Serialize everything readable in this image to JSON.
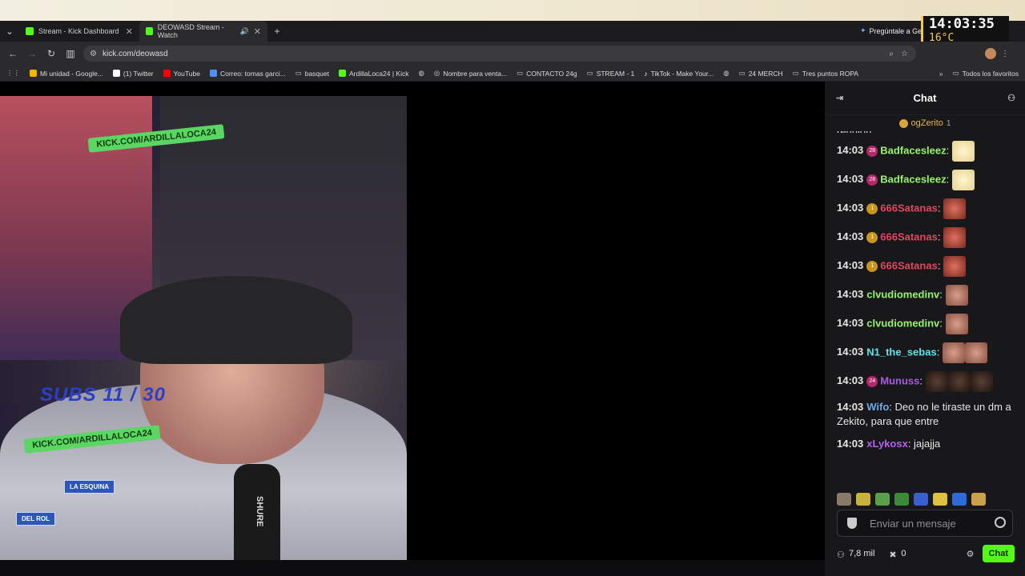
{
  "tabs": [
    {
      "title": "Stream - Kick Dashboard"
    },
    {
      "title": "DEOWASD Stream - Watch"
    }
  ],
  "gemini_prompt": "Pregúntale a Gemini",
  "clock": {
    "time": "14:03:35",
    "temp": "16°C"
  },
  "address": {
    "url": "kick.com/deowasd"
  },
  "bookmarks": [
    {
      "label": "Mi unidad - Google...",
      "color": "#f4b400"
    },
    {
      "label": "(1) Twitter",
      "color": "#ffffff"
    },
    {
      "label": "YouTube",
      "color": "#ff0000"
    },
    {
      "label": "Correo: tomas garci...",
      "color": "#4f8ef7"
    },
    {
      "label": "basquet",
      "color": "#aaaaaa"
    },
    {
      "label": "ArdillaLoca24 | Kick",
      "color": "#53fc18"
    },
    {
      "label": "",
      "color": "#cccccc"
    },
    {
      "label": "Nombre para venta...",
      "color": "#cccccc"
    },
    {
      "label": "CONTACTO 24g",
      "color": "#aaaaaa"
    },
    {
      "label": "STREAM - 1",
      "color": "#aaaaaa"
    },
    {
      "label": "TikTok - Make Your...",
      "color": "#ffffff"
    },
    {
      "label": "",
      "color": "#cccccc"
    },
    {
      "label": "24 MERCH",
      "color": "#aaaaaa"
    },
    {
      "label": "Tres puntos  ROPA",
      "color": "#aaaaaa"
    }
  ],
  "bookmarks_all": "Todos los favoritos",
  "overlay": {
    "banner_top": "KICK.COM/ARDILLALOCA24",
    "banner_bottom": "KICK.COM/ARDILLALOCA24",
    "subs": "SUBS 11 / 30",
    "sign1": "LA ESQUINA",
    "sign2": "DEL ROL",
    "mic_brand": "SHURE"
  },
  "chat": {
    "title": "Chat",
    "pinned_user": "ogZerito",
    "pinned_count": "1",
    "partial_text": "reunion",
    "messages": [
      {
        "time": "14:03",
        "badge": "28",
        "badge_color": "#b3286a",
        "user": "Badfacesleez",
        "user_color": "#9af26a",
        "text": "",
        "emotes": [
          "anime"
        ]
      },
      {
        "time": "14:03",
        "badge": "28",
        "badge_color": "#b3286a",
        "user": "Badfacesleez",
        "user_color": "#9af26a",
        "text": "",
        "emotes": [
          "anime"
        ]
      },
      {
        "time": "14:03",
        "badge": "1",
        "badge_color": "#c8951f",
        "user": "666Satanas",
        "user_color": "#e0475d",
        "text": "",
        "emotes": [
          "red"
        ]
      },
      {
        "time": "14:03",
        "badge": "1",
        "badge_color": "#c8951f",
        "user": "666Satanas",
        "user_color": "#e0475d",
        "text": "",
        "emotes": [
          "red"
        ]
      },
      {
        "time": "14:03",
        "badge": "1",
        "badge_color": "#c8951f",
        "user": "666Satanas",
        "user_color": "#e0475d",
        "text": "",
        "emotes": [
          "red"
        ]
      },
      {
        "time": "14:03",
        "badge": "",
        "badge_color": "",
        "user": "clvudiomedinv",
        "user_color": "#9af26a",
        "text": "",
        "emotes": [
          "face"
        ]
      },
      {
        "time": "14:03",
        "badge": "",
        "badge_color": "",
        "user": "clvudiomedinv",
        "user_color": "#9af26a",
        "text": "",
        "emotes": [
          "face"
        ]
      },
      {
        "time": "14:03",
        "badge": "",
        "badge_color": "",
        "user": "N1_the_sebas",
        "user_color": "#5fe3e8",
        "text": "",
        "emotes": [
          "face",
          "face"
        ]
      },
      {
        "time": "14:03",
        "badge": "24",
        "badge_color": "#b3286a",
        "user": "Munuss",
        "user_color": "#a95ae6",
        "text": "",
        "emotes": [
          "dark",
          "dark",
          "dark"
        ]
      },
      {
        "time": "14:03",
        "badge": "",
        "badge_color": "",
        "user": "Wifo",
        "user_color": "#6fa7ea",
        "text": "Deo no le tiraste un dm a Zekito, para que entre",
        "emotes": []
      },
      {
        "time": "14:03",
        "badge": "",
        "badge_color": "",
        "user": "xLykosx",
        "user_color": "#b45ff2",
        "text": "jajajja",
        "emotes": []
      }
    ],
    "input_placeholder": "Enviar un mensaje",
    "viewers": "7,8 mil",
    "points": "0",
    "send_label": "Chat"
  }
}
